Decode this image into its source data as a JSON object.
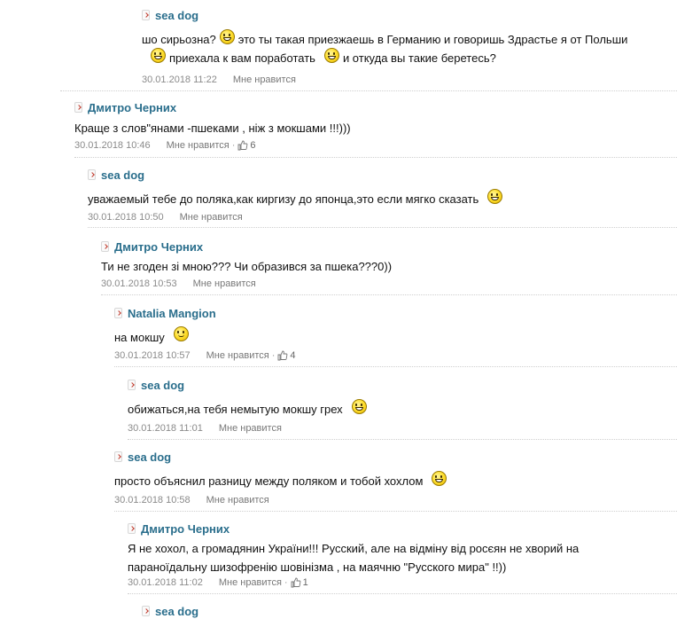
{
  "comments": [
    {
      "author": "sea dog",
      "text_parts": [
        "шо сирьозна?",
        "это ты такая приезжаешь в Германию и говоришь Здрастье я от Польши",
        "приехала к вам поработать",
        "и откуда вы такие беретесь?"
      ],
      "date": "30.01.2018 11:22",
      "like_label": "Мне нравится"
    },
    {
      "author": "Дмитро Черних",
      "text": "Краще з слов\"янами -пшеками , ніж з мокшами !!!)))",
      "date": "30.01.2018 10:46",
      "like_label": "Мне нравится",
      "like_sep": "·",
      "likes": "6"
    },
    {
      "author": "sea dog",
      "text": "уважаемый тебе до поляка,как киргизу до японца,это если мягко сказать",
      "date": "30.01.2018 10:50",
      "like_label": "Мне нравится"
    },
    {
      "author": "Дмитро Черних",
      "text": "Ти не згоден зі мною??? Чи образився за пшека???0))",
      "date": "30.01.2018 10:53",
      "like_label": "Мне нравится"
    },
    {
      "author": "Natalia Mangion",
      "text": "на мокшу",
      "date": "30.01.2018 10:57",
      "like_label": "Мне нравится",
      "like_sep": "·",
      "likes": "4"
    },
    {
      "author": "sea dog",
      "text": "обижаться,на тебя немытую мокшу грех",
      "date": "30.01.2018 11:01",
      "like_label": "Мне нравится"
    },
    {
      "author": "sea dog",
      "text": "просто объяснил разницу между поляком и тобой хохлом",
      "date": "30.01.2018 10:58",
      "like_label": "Мне нравится"
    },
    {
      "author": "Дмитро Черних",
      "text_lines": [
        "Я не хохол, а громадянин України!!! Русский, але на відміну від росєян не хворий на",
        "параноїдальну шизофренію шовінізма , на маячню \"Русского мира\" !!))"
      ],
      "date": "30.01.2018 11:02",
      "like_label": "Мне нравится",
      "like_sep": "·",
      "likes": "1"
    },
    {
      "author": "sea dog"
    }
  ],
  "icons": {
    "reply_arrow": "chevron-right-icon",
    "like": "thumbs-up-icon",
    "smiley": "smiley-icon"
  },
  "colors": {
    "author": "#2a6e8c",
    "meta": "#8a8a8a",
    "arrow": "#c0392b"
  }
}
